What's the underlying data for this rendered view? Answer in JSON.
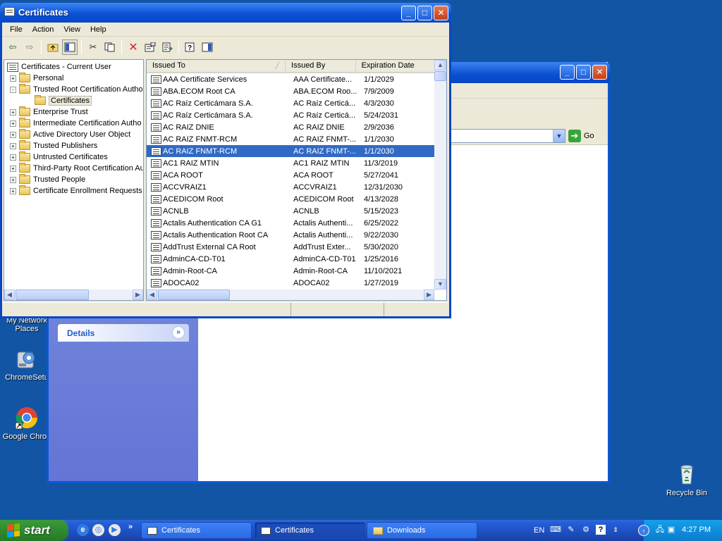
{
  "desktop": {
    "icons": [
      {
        "label_lines": [
          "My Network",
          "Places"
        ]
      },
      {
        "label_lines": [
          "ChromeSetu"
        ]
      },
      {
        "label_lines": [
          "Google Chron"
        ]
      },
      {
        "label_lines": [
          "Recycle Bin"
        ]
      }
    ]
  },
  "background_window": {
    "address_go_label": "Go",
    "details_label": "Details"
  },
  "mmc": {
    "title": "Certificates",
    "menu": [
      "File",
      "Action",
      "View",
      "Help"
    ],
    "tree": {
      "root": "Certificates - Current User",
      "items": [
        {
          "label": "Personal",
          "expander": "+"
        },
        {
          "label": "Trusted Root Certification Autho",
          "expander": "-"
        },
        {
          "label": "Certificates",
          "expander": ""
        },
        {
          "label": "Enterprise Trust",
          "expander": "+"
        },
        {
          "label": "Intermediate Certification Autho",
          "expander": "+"
        },
        {
          "label": "Active Directory User Object",
          "expander": "+"
        },
        {
          "label": "Trusted Publishers",
          "expander": "+"
        },
        {
          "label": "Untrusted Certificates",
          "expander": "+"
        },
        {
          "label": "Third-Party Root Certification Au",
          "expander": "+"
        },
        {
          "label": "Trusted People",
          "expander": "+"
        },
        {
          "label": "Certificate Enrollment Requests",
          "expander": "+"
        }
      ]
    },
    "columns": [
      "Issued To",
      "Issued By",
      "Expiration Date"
    ],
    "rows": [
      [
        "AAA Certificate Services",
        "AAA Certificate...",
        "1/1/2029"
      ],
      [
        "ABA.ECOM Root CA",
        "ABA.ECOM Roo...",
        "7/9/2009"
      ],
      [
        "AC Raíz Certicámara S.A.",
        "AC Raíz Certicá...",
        "4/3/2030"
      ],
      [
        "AC Raíz Certicámara S.A.",
        "AC Raíz Certicá...",
        "5/24/2031"
      ],
      [
        "AC RAIZ DNIE",
        "AC RAIZ DNIE",
        "2/9/2036"
      ],
      [
        "AC RAIZ FNMT-RCM",
        "AC RAIZ FNMT-...",
        "1/1/2030"
      ],
      [
        "AC RAIZ FNMT-RCM",
        "AC RAIZ FNMT-...",
        "1/1/2030"
      ],
      [
        "AC1 RAIZ MTIN",
        "AC1 RAIZ MTIN",
        "11/3/2019"
      ],
      [
        "ACA ROOT",
        "ACA ROOT",
        "5/27/2041"
      ],
      [
        "ACCVRAIZ1",
        "ACCVRAIZ1",
        "12/31/2030"
      ],
      [
        "ACEDICOM Root",
        "ACEDICOM Root",
        "4/13/2028"
      ],
      [
        "ACNLB",
        "ACNLB",
        "5/15/2023"
      ],
      [
        "Actalis Authentication CA G1",
        "Actalis Authenti...",
        "6/25/2022"
      ],
      [
        "Actalis Authentication Root CA",
        "Actalis Authenti...",
        "9/22/2030"
      ],
      [
        "AddTrust External CA Root",
        "AddTrust Exter...",
        "5/30/2020"
      ],
      [
        "AdminCA-CD-T01",
        "AdminCA-CD-T01",
        "1/25/2016"
      ],
      [
        "Admin-Root-CA",
        "Admin-Root-CA",
        "11/10/2021"
      ],
      [
        "ADOCA02",
        "ADOCA02",
        "1/27/2019"
      ]
    ],
    "selected_row_index": 6
  },
  "taskbar": {
    "start_label": "start",
    "buttons": [
      {
        "label": "Certificates",
        "icon": "certificate-icon"
      },
      {
        "label": "Certificates",
        "icon": "certificate-icon"
      },
      {
        "label": "Downloads",
        "icon": "folder-icon"
      }
    ],
    "language": "EN",
    "time": "4:27 PM"
  },
  "colors": {
    "desktop": "#1255a4",
    "selection": "#316ac5",
    "title_blue": "#0b52d6",
    "start_green": "#2f8a2f"
  }
}
